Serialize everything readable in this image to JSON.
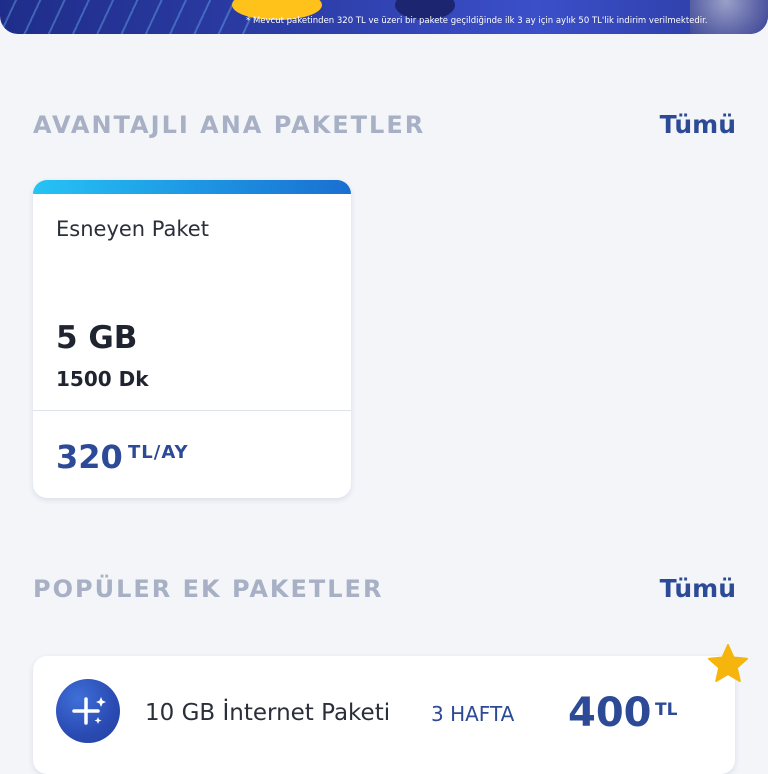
{
  "banner": {
    "note": "* Mevcut paketinden 320 TL ve üzeri bir pakete geçildiğinde ilk 3 ay için aylık 50 TL'lik indirim verilmektedir."
  },
  "main_packages": {
    "title": "AVANTAJLI ANA PAKETLER",
    "see_all": "Tümü",
    "card": {
      "name": "Esneyen Paket",
      "data": "5 GB",
      "minutes": "1500 Dk",
      "price": "320",
      "unit": "TL/AY",
      "accent": "#1d8fe0"
    }
  },
  "addon_packages": {
    "title": "POPÜLER EK PAKETLER",
    "see_all": "Tümü",
    "item": {
      "icon": "sparkle-plus-icon",
      "name": "10 GB İnternet Paketi",
      "duration": "3 HAFTA",
      "price": "400",
      "unit": "TL",
      "badge_icon": "star-icon"
    }
  },
  "colors": {
    "brand": "#2c4a96",
    "section_title": "#a7b0c4",
    "star": "#f5b50c",
    "background": "#f3f5f9"
  }
}
